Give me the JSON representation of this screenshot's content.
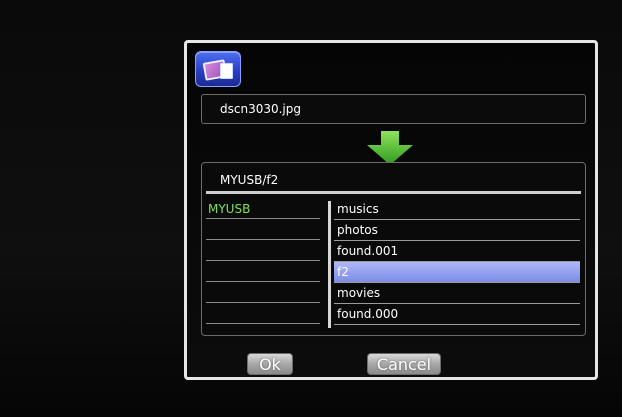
{
  "dialog": {
    "source_filename": "dscn3030.jpg",
    "destination_path": "MYUSB/f2"
  },
  "left_column": {
    "items": [
      "MYUSB",
      "",
      "",
      "",
      "",
      ""
    ]
  },
  "right_column": {
    "items": [
      "musics",
      "photos",
      "found.001",
      "f2",
      "movies",
      "found.000"
    ],
    "selected": "f2"
  },
  "buttons": {
    "ok_label": "Ok",
    "cancel_label": "Cancel"
  },
  "icons": {
    "app": "photo-copy-icon",
    "arrow": "arrow-down-icon"
  },
  "colors": {
    "accent_green": "#7fe05a",
    "selection": "#8f9cf0",
    "icon_blue": "#2b3fc6"
  }
}
